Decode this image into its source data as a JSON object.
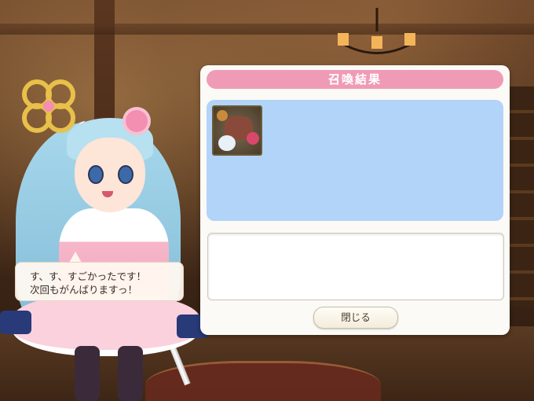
{
  "dialog": {
    "title": "召喚結果",
    "close_label": "閉じる",
    "result_items": [
      {
        "icon": "summoned-item-icon"
      }
    ],
    "message": ""
  },
  "character": {
    "speech_lines": [
      "す、す、すごかったです！",
      "次回もがんばりますっ！"
    ]
  },
  "colors": {
    "header": "#f09bb6",
    "result_area": "#b2d4f8",
    "panel": "#fbfaf7"
  }
}
